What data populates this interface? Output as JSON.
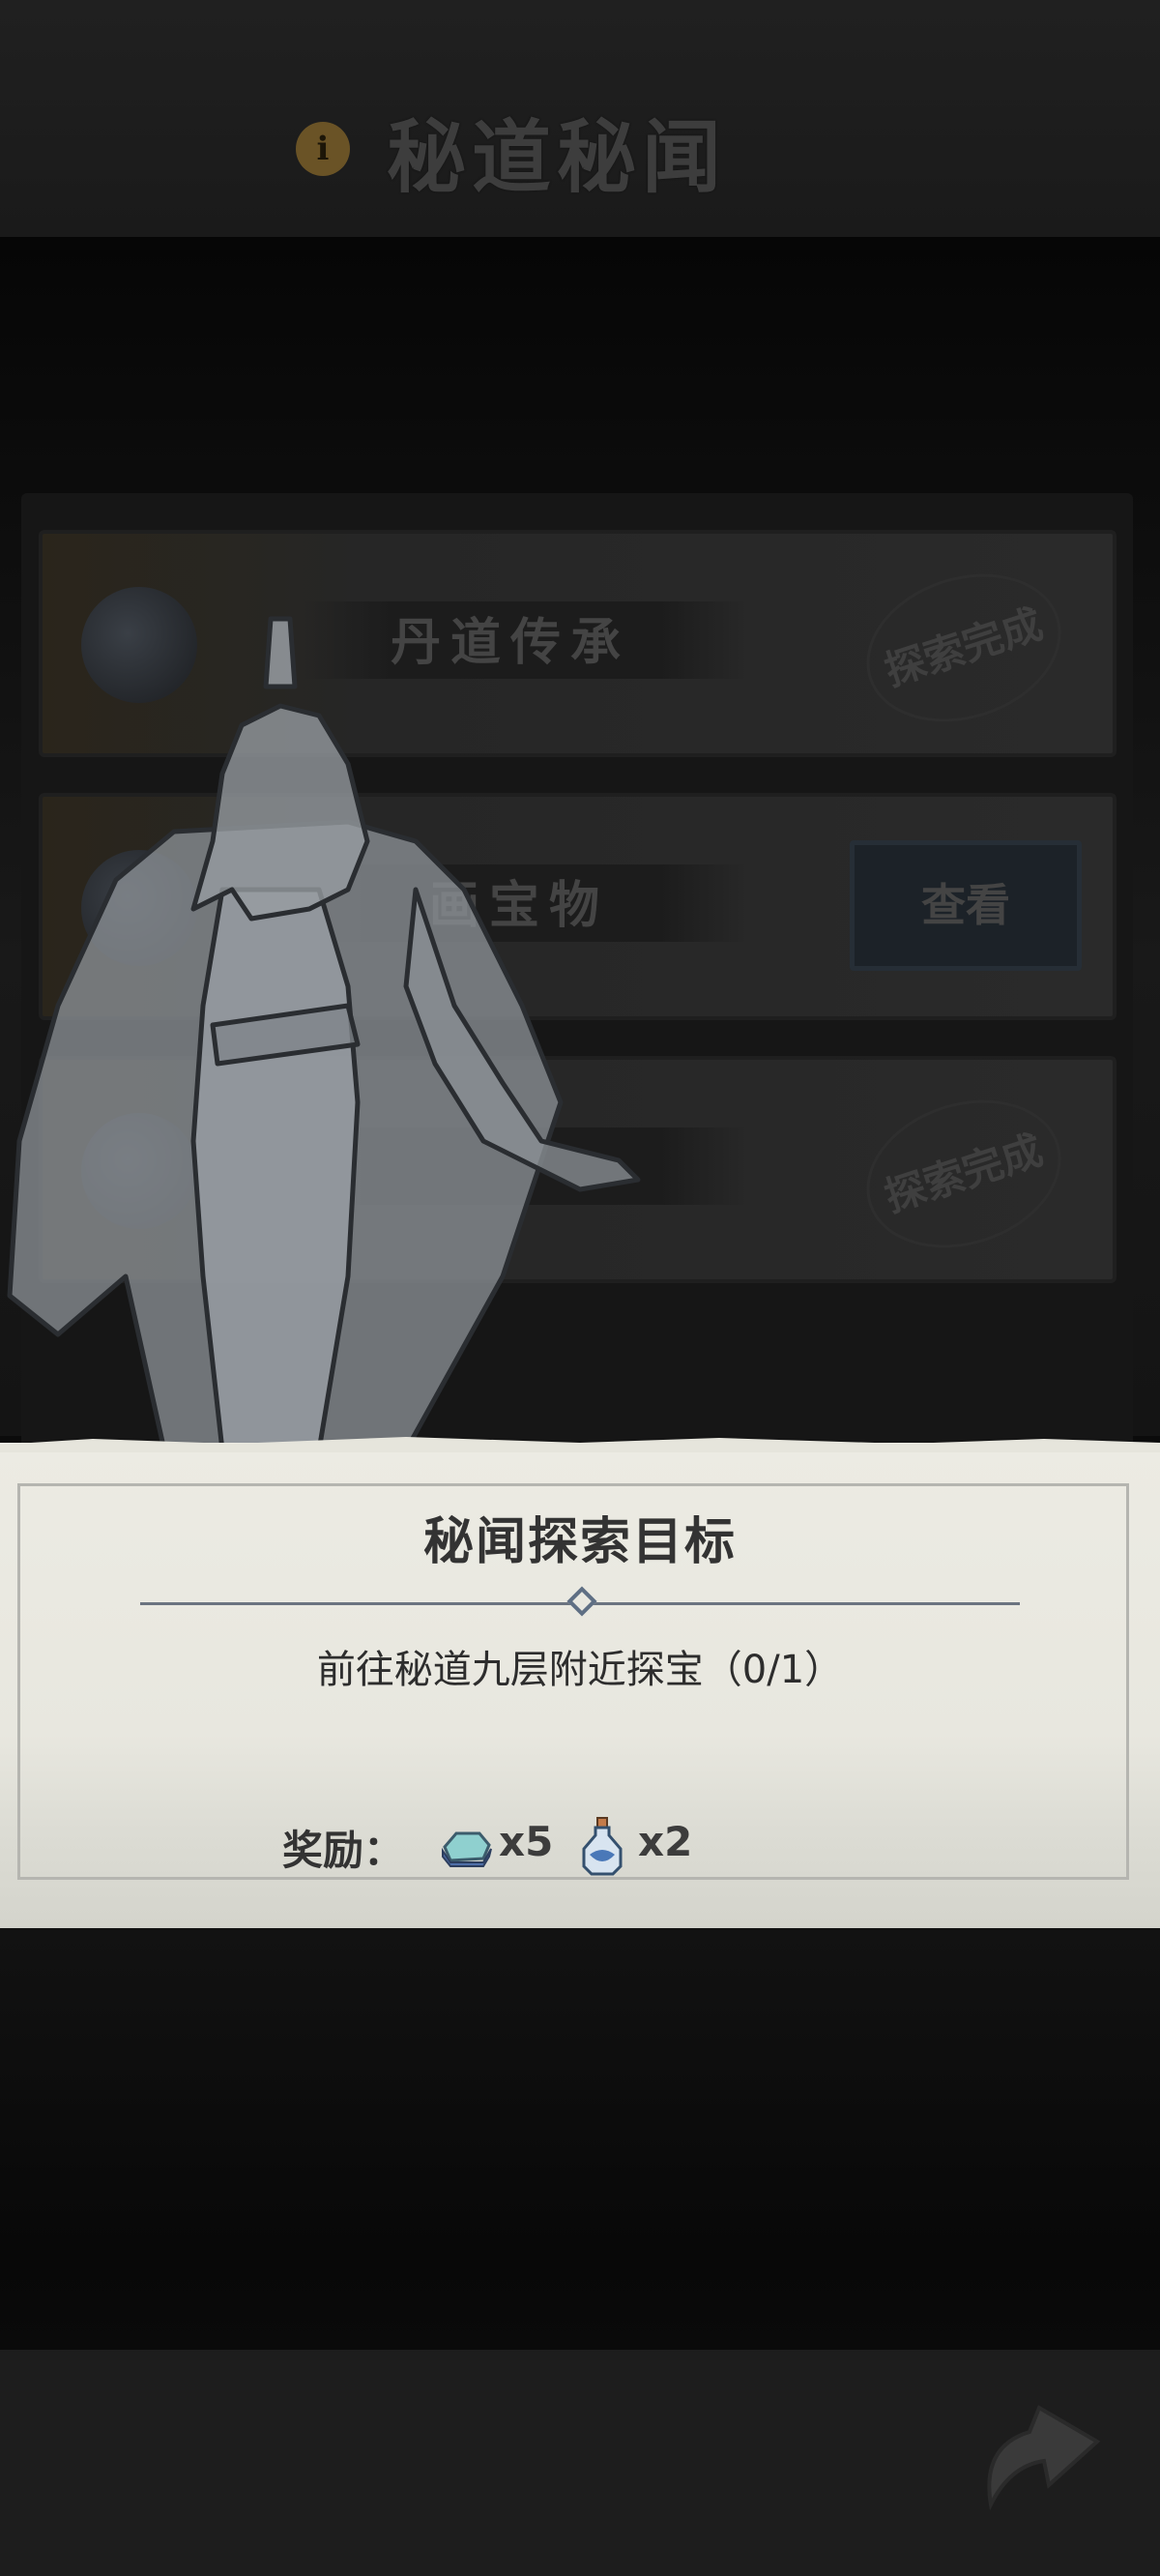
{
  "header": {
    "info_icon_glyph": "i",
    "title": "秘道秘闻"
  },
  "quest_list": [
    {
      "name": "丹道传承",
      "status": "探索完成",
      "icon": "gourd-icon"
    },
    {
      "name": "画宝物",
      "action": "查看",
      "icon": "magnifier-icon"
    },
    {
      "name": "",
      "status": "探索完成",
      "icon": "scroll-icon"
    }
  ],
  "dialog": {
    "title": "秘闻探索目标",
    "objective": "前往秘道九层附近探宝（0/1）",
    "reward_label": "奖励：",
    "rewards": [
      {
        "icon": "jade-stone-icon",
        "count": "x5"
      },
      {
        "icon": "medicine-bottle-icon",
        "count": "x2"
      }
    ]
  },
  "footer": {
    "return_icon": "return-arrow-icon"
  },
  "colors": {
    "dialog_bg": "#ecebe3",
    "dialog_text": "#333333",
    "divider": "#6b7480",
    "overlay_dim": "#0b0b0b"
  }
}
